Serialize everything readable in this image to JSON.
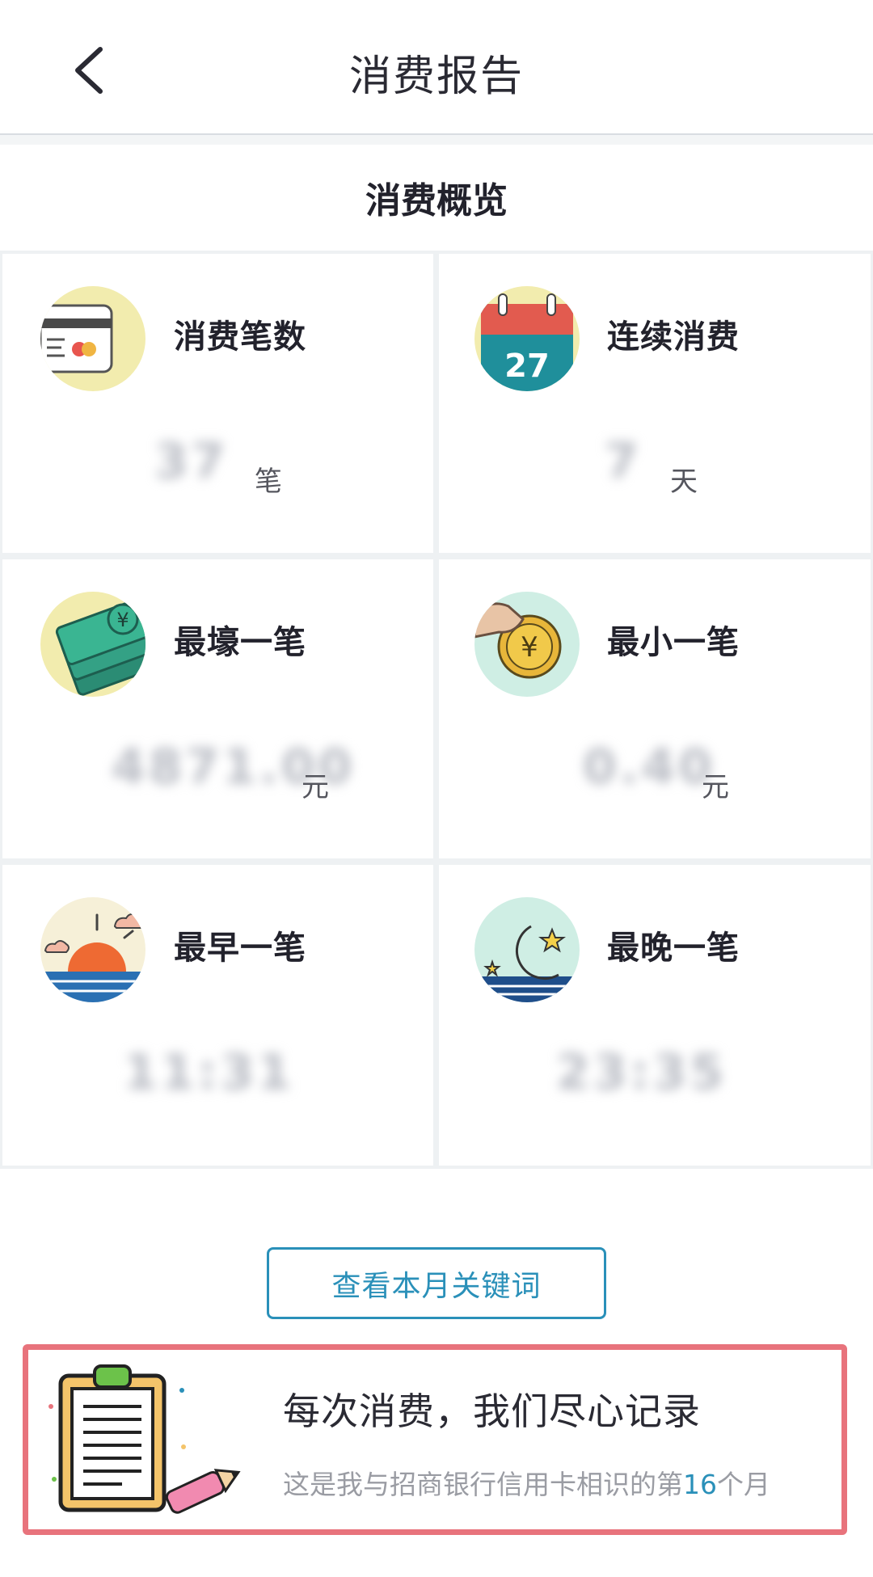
{
  "header": {
    "title": "消费报告"
  },
  "overview": {
    "title": "消费概览",
    "cards": [
      {
        "label": "消费笔数",
        "value": "37",
        "unit": "笔",
        "icon": "credit-card-icon"
      },
      {
        "label": "连续消费",
        "value": "7",
        "unit": "天",
        "icon": "calendar-icon"
      },
      {
        "label": "最壕一笔",
        "value": "4871.00",
        "unit": "元",
        "icon": "money-stack-icon"
      },
      {
        "label": "最小一笔",
        "value": "0.40",
        "unit": "元",
        "icon": "coin-icon"
      },
      {
        "label": "最早一笔",
        "value": "11:31",
        "unit": "",
        "icon": "sunrise-icon"
      },
      {
        "label": "最晚一笔",
        "value": "23:35",
        "unit": "",
        "icon": "moon-icon"
      }
    ],
    "calendar_day": "27"
  },
  "keywords_button": {
    "label": "查看本月关键词"
  },
  "banner": {
    "title": "每次消费，我们尽心记录",
    "subtitle_prefix": "这是我与招商银行信用卡相识的第",
    "months": "16",
    "subtitle_suffix": "个月"
  },
  "colors": {
    "accent": "#2a90b9",
    "banner_border": "#e8737c"
  }
}
